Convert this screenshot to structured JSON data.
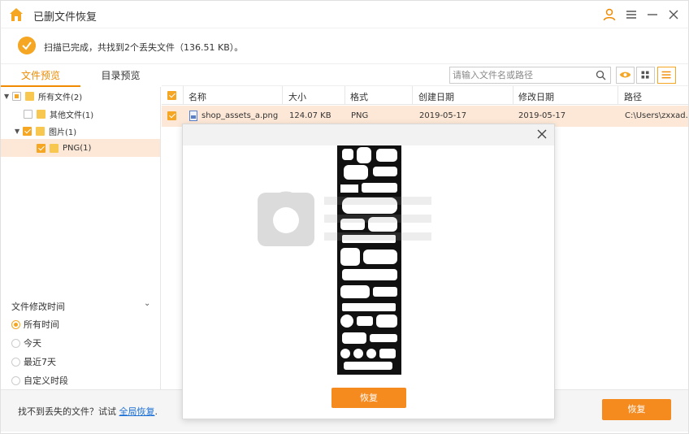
{
  "window": {
    "title": "已删文件恢复"
  },
  "titlebar": {
    "user_icon": "user-icon",
    "menu_icon": "menu-icon",
    "minimize_icon": "minimize-icon",
    "close_icon": "close-icon"
  },
  "status": {
    "text": "扫描已完成，共找到2个丢失文件（136.51 KB）。"
  },
  "tabs": [
    {
      "label": "文件预览",
      "active": true
    },
    {
      "label": "目录预览",
      "active": false
    }
  ],
  "tree": [
    {
      "label": "所有文件(2)"
    },
    {
      "label": "其他文件(1)"
    },
    {
      "label": "图片(1)"
    },
    {
      "label": "PNG(1)"
    }
  ],
  "filter": {
    "title": "文件修改时间",
    "options": [
      {
        "label": "所有时间",
        "selected": true
      },
      {
        "label": "今天"
      },
      {
        "label": "最近7天"
      },
      {
        "label": "自定义时段"
      }
    ]
  },
  "search": {
    "placeholder": "请输入文件名或路径"
  },
  "table": {
    "headers": [
      "名称",
      "大小",
      "格式",
      "创建日期",
      "修改日期",
      "路径"
    ],
    "rows": [
      {
        "name": "shop_assets_a.png",
        "size": "124.07 KB",
        "format": "PNG",
        "created": "2019-05-17",
        "modified": "2019-05-17",
        "path": "C:\\Users\\zxxad..."
      }
    ]
  },
  "dialog": {
    "restore_label": "恢复"
  },
  "bottom": {
    "hint_prefix": "找不到丢失的文件？试试 ",
    "hint_link": "全局恢复",
    "hint_suffix": ".",
    "restore_label": "恢复"
  },
  "colors": {
    "accent": "#f58a1f",
    "selected_row": "#fde8d7",
    "link": "#1a6fd6"
  }
}
